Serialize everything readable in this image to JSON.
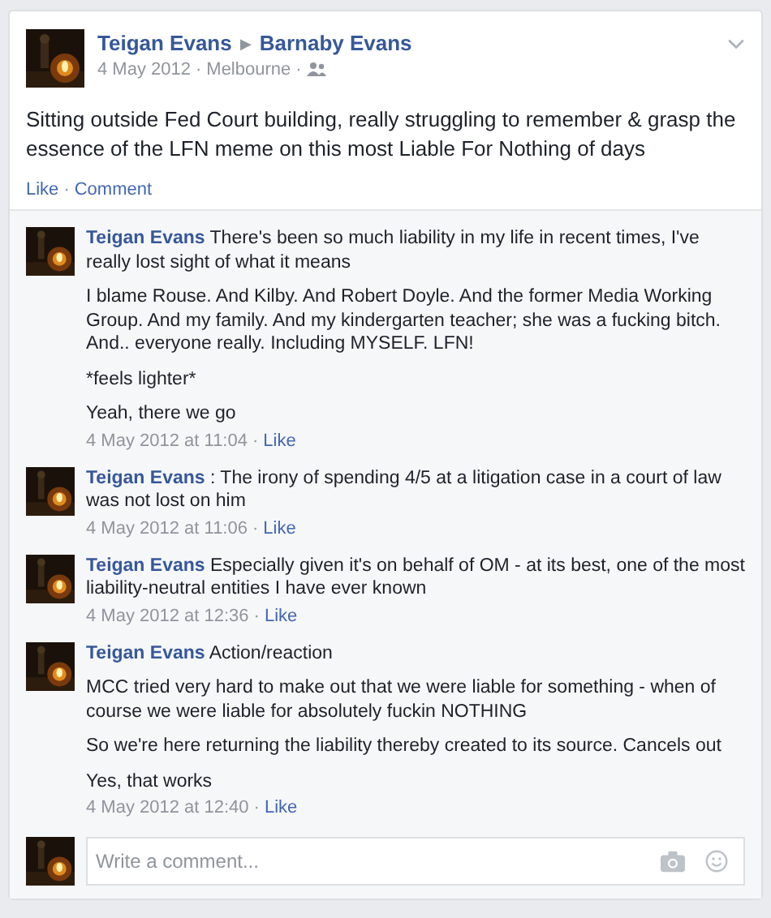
{
  "post": {
    "author": "Teigan Evans",
    "separator": "▶",
    "target": "Barnaby Evans",
    "date": "4 May 2012",
    "location": "Melbourne",
    "dot": "·",
    "text": "Sitting outside Fed Court building, really struggling to remember & grasp the essence of the LFN meme on this most Liable For Nothing of days",
    "actions": [
      "Like",
      "Comment"
    ],
    "actions_dot": "·"
  },
  "comments": [
    {
      "author": "Teigan Evans",
      "paragraphs": [
        "There's been so much liability in my life in recent times, I've really lost sight of what it means",
        "I blame Rouse. And Kilby. And Robert Doyle. And the former Media Working Group. And my family. And my kindergarten teacher; she was a fucking bitch. And.. everyone really. Including MYSELF. LFN!",
        "*feels lighter*",
        "Yeah, there we go"
      ],
      "time": "4 May 2012 at 11:04",
      "dot": "·",
      "action": "Like"
    },
    {
      "author": "Teigan Evans",
      "paragraphs": [
        ": The irony of spending 4/5 at a litigation case in a court of law was not lost on him"
      ],
      "time": "4 May 2012 at 11:06",
      "dot": "·",
      "action": "Like"
    },
    {
      "author": "Teigan Evans",
      "paragraphs": [
        "Especially given it's on behalf of OM - at its best, one of the most liability-neutral entities I have ever known"
      ],
      "time": "4 May 2012 at 12:36",
      "dot": "·",
      "action": "Like"
    },
    {
      "author": "Teigan Evans",
      "paragraphs": [
        "Action/reaction",
        "MCC tried very hard to make out that we were liable for something - when of course we were liable for absolutely fuckin NOTHING",
        "So we're here returning the liability thereby created to its source. Cancels out",
        "Yes, that works"
      ],
      "time": "4 May 2012 at 12:40",
      "dot": "·",
      "action": "Like"
    }
  ],
  "composer": {
    "placeholder": "Write a comment..."
  }
}
